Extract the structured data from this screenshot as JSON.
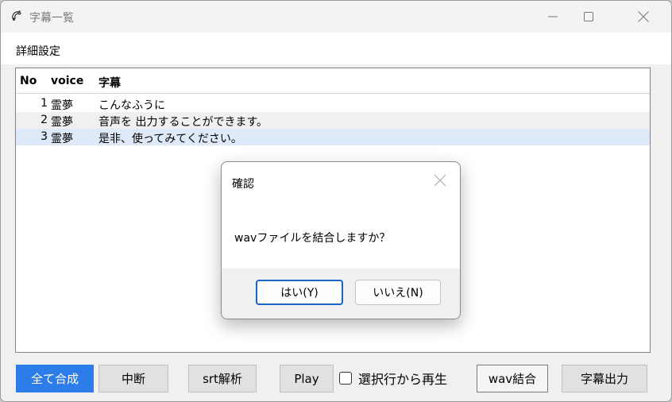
{
  "window": {
    "title": "字幕一覧",
    "menu": [
      "詳細設定"
    ]
  },
  "table": {
    "headers": {
      "no": "No",
      "voice": "voice",
      "text": "字幕"
    },
    "rows": [
      {
        "no": "1",
        "voice": "霊夢",
        "text": "こんなふうに",
        "selected": false
      },
      {
        "no": "2",
        "voice": "霊夢",
        "text": "音声を 出力することができます。",
        "selected": false
      },
      {
        "no": "3",
        "voice": "霊夢",
        "text": "是非、使ってみてください。",
        "selected": true
      }
    ]
  },
  "toolbar": {
    "synthesize_all": "全て合成",
    "abort": "中断",
    "srt_parse": "srt解析",
    "play": "Play",
    "play_from_selected": "選択行から再生",
    "wav_join": "wav結合",
    "subtitle_output": "字幕出力"
  },
  "dialog": {
    "title": "確認",
    "message": "wavファイルを結合しますか？",
    "yes": "はい(Y)",
    "no": "いいえ(N)"
  },
  "colors": {
    "accent": "#2c7de9",
    "row_alt": "#f0f0f0",
    "row_selected": "#deeaf9",
    "dialog_default_border": "#1a66c7"
  }
}
